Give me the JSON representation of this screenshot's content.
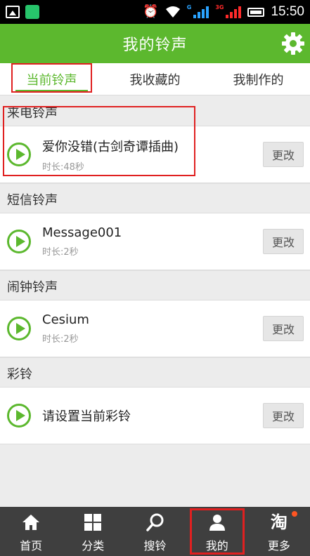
{
  "status_bar": {
    "time": "15:50",
    "net_type_1": "G",
    "net_type_2": "3G",
    "icons": [
      "image-icon",
      "app-notification-icon",
      "alarm-icon",
      "wifi-icon",
      "signal-icon",
      "signal-3g-icon",
      "battery-icon"
    ]
  },
  "title_bar": {
    "title": "我的铃声",
    "settings_icon": "gear-icon"
  },
  "tabs": [
    {
      "label": "当前铃声",
      "active": true
    },
    {
      "label": "我收藏的",
      "active": false
    },
    {
      "label": "我制作的",
      "active": false
    }
  ],
  "sections": [
    {
      "header": "来电铃声",
      "song": "爱你没错(古剑奇谭插曲)",
      "duration": "时长:48秒",
      "button": "更改"
    },
    {
      "header": "短信铃声",
      "song": "Message001",
      "duration": "时长:2秒",
      "button": "更改"
    },
    {
      "header": "闹钟铃声",
      "song": "Cesium",
      "duration": "时长:2秒",
      "button": "更改"
    },
    {
      "header": "彩铃",
      "song": "请设置当前彩铃",
      "duration": "",
      "button": "更改"
    }
  ],
  "bottom_nav": [
    {
      "label": "首页",
      "icon": "home-icon"
    },
    {
      "label": "分类",
      "icon": "grid-icon"
    },
    {
      "label": "搜铃",
      "icon": "search-icon"
    },
    {
      "label": "我的",
      "icon": "user-icon",
      "active": true
    },
    {
      "label": "更多",
      "icon": "taobao-icon",
      "icon_text": "淘"
    }
  ],
  "colors": {
    "accent": "#5cb82e",
    "highlight_box": "#e02020",
    "nav_bg": "#3f3f3f"
  }
}
